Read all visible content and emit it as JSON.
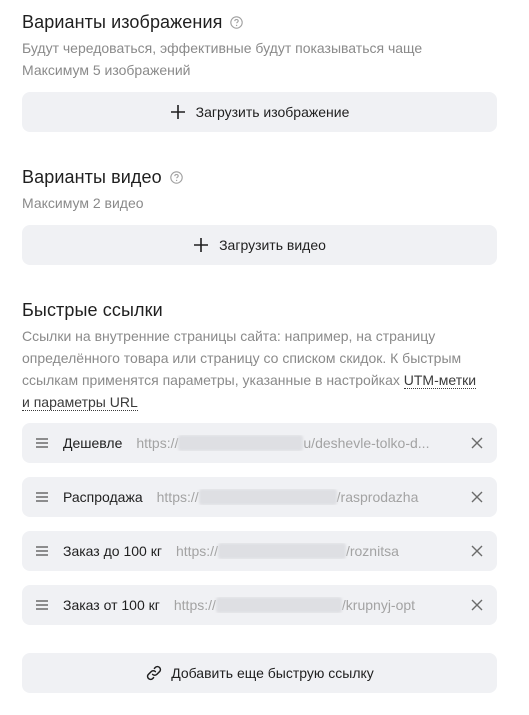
{
  "images": {
    "title": "Варианты изображения",
    "desc_line1": "Будут чередоваться, эффективные будут показываться чаще",
    "desc_line2": "Максимум 5 изображений",
    "upload_label": "Загрузить изображение"
  },
  "videos": {
    "title": "Варианты видео",
    "desc": "Максимум 2 видео",
    "upload_label": "Загрузить видео"
  },
  "quick_links": {
    "title": "Быстрые ссылки",
    "desc_line1": "Ссылки на внутренние страницы сайта: например, на страницу",
    "desc_line2": "определённого товара или страницу со списком скидок. К быстрым",
    "desc_line3_prefix": "ссылкам применятся параметры, указанные в настройках",
    "desc_link_part1": "UTM-метки",
    "desc_link_part2": "и параметры URL",
    "items": [
      {
        "label": "Дешевле",
        "url_prefix": "https://",
        "url_suffix": "u/deshevle-tolko-d..."
      },
      {
        "label": "Распродажа",
        "url_prefix": "https://",
        "url_suffix": "/rasprodazha"
      },
      {
        "label": "Заказ до 100 кг",
        "url_prefix": "https://",
        "url_suffix": "/roznitsa"
      },
      {
        "label": "Заказ от 100 кг",
        "url_prefix": "https://",
        "url_suffix": "/krupnyj-opt"
      }
    ],
    "add_label": "Добавить еще быструю ссылку"
  },
  "icons": {
    "help": "question-circle-icon",
    "plus": "plus-icon",
    "drag": "drag-handle-icon",
    "close": "close-icon",
    "link": "chain-link-icon"
  },
  "colors": {
    "button_bg": "#f0f1f4",
    "text_primary": "#1f1f1f",
    "text_secondary": "#8a8a8a",
    "url_text": "#a3a3a3"
  }
}
